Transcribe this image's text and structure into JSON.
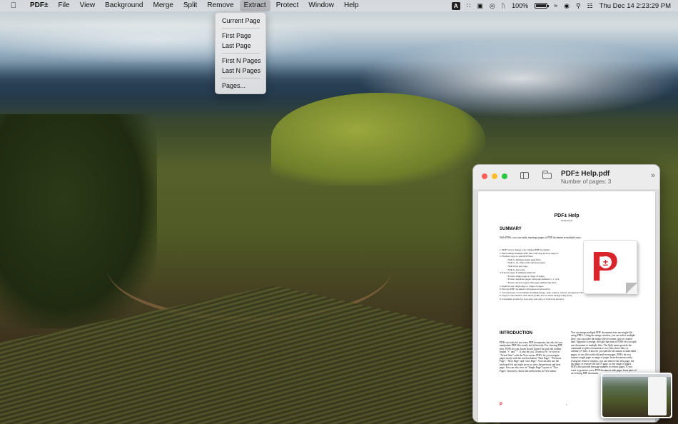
{
  "menubar": {
    "apple_icon": "apple-logo-icon",
    "app_name": "PDF±",
    "menus": [
      "File",
      "View",
      "Background",
      "Merge",
      "Split",
      "Remove",
      "Extract",
      "Protect",
      "Window",
      "Help"
    ],
    "active_menu": "Extract",
    "status": {
      "input_badge": "A",
      "battery_percent": "100%",
      "battery_level": 1.0,
      "datetime": "Thu Dec 14  2:23:29 PM"
    }
  },
  "extract_menu": {
    "items_group1": [
      "Current Page"
    ],
    "items_group2": [
      "First Page",
      "Last Page"
    ],
    "items_group3": [
      "First N Pages",
      "Last N Pages"
    ],
    "items_group4": [
      "Pages..."
    ]
  },
  "preview_window": {
    "title": "PDF± Help.pdf",
    "subtitle": "Number of pages: 3",
    "document": {
      "title": "PDF± Help",
      "version": "Version 6.0",
      "summary_heading": "SUMMARY",
      "summary_intro": "With PDF±, you can easily rearrange pages of PDF document in multiple ways:",
      "summary_items": [
        "1.   PDF± never change your original PDF document.",
        "2.   Batch merge multiple PDF files with drag & drop support.",
        "3.   Flexible ways to split PDF files:",
        "•  Split to multiple single page files;",
        "•  Split to two files with odd/even pages;",
        "•  Split from any page;",
        "•  Split to any parts.",
        "4.   Extract pages in multiple methods:",
        "•  Extract single page or range of pages;",
        "•  Extract duplicate pages with page numbers 1, 1, 4, 6;",
        "•  Extract inverse pages with page number like 99-1;",
        "5.   Remove any single page or range of pages.",
        "6.   Encrypt PDF document with password protection",
        "7.   All operations on document including merge, split, remove, extract, encryption will create new PDF document.",
        "8.   Support view PDF in dark mode (white text on black background) (test).",
        "9.   Customize toolbar for icon only, text only, or both icon and text."
      ],
      "intro_heading": "INTRODUCTION",
      "intro_left": "PDF± not only let you view PDF documents, but also let you manipulate PDF files easily and efficiently. For viewing PDF files, PDF± let you Zoom In and Zoom Out with the toolbar button \"+\" and \"-\". It also let you \"Zoom to Fit\" or view in \"Actual Size\" with the View menu. PDF± let you navigate pages easily with the tool bar button \"First Page\", \"Previous Page\", \"Next Page\" and \"Last Page\". You can also use the keyboard left and right arrow to view the previous and next page. You can also view in \"Single Page\" layout or \"Two Pages\" layout by choose the menu items in View menu.",
      "intro_right": "You can merge multiple PDF documents into one single file using PDF±. Using the merge window, you can select multiple files; you can order the merge files by name, size or created date. Opposite to merge, the split function of PDF± let you split one document to multiple files. The Split menu provide the command to split a document to two files, three files, or arbitrary N files. It also let you split the document to individual pages, to two files with odd and even pages. PDF± let you remove single page or range of pages from document easily. Using the remove window, you can remove the first page, the last page, or remove the last N page, or any range of pages. PDF± also provide the page number to extract pages. If you want to generate a new PDF document with pages from parts of an existing PDF document,",
      "page_number": "1"
    }
  },
  "colors": {
    "accent_red": "#d8252c",
    "traffic_red": "#fe5f57",
    "traffic_yellow": "#febc2e",
    "traffic_green": "#28c840"
  }
}
